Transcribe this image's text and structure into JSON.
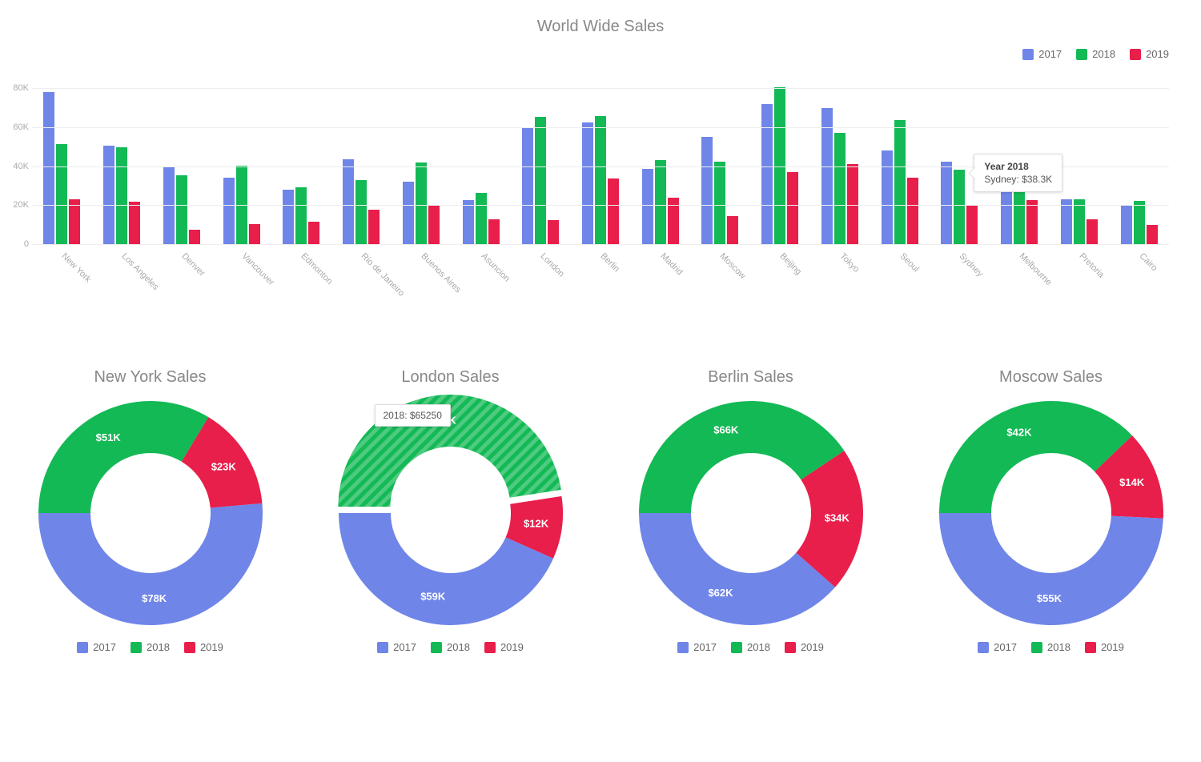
{
  "colors": {
    "2017": "#6f85e8",
    "2018": "#13b955",
    "2019": "#e81e4b"
  },
  "chart_data": [
    {
      "id": "bar",
      "type": "bar",
      "title": "World Wide Sales",
      "ylim": [
        0,
        80000
      ],
      "yticks": [
        0,
        20000,
        40000,
        60000,
        80000
      ],
      "ytick_labels": [
        "0",
        "20K",
        "40K",
        "60K",
        "80K"
      ],
      "categories": [
        "New York",
        "Los Angeles",
        "Denver",
        "Vancouver",
        "Edmonton",
        "Rio de Janeiro",
        "Buenos Aires",
        "Asuncion",
        "London",
        "Berlin",
        "Madrid",
        "Moscow",
        "Beijing",
        "Tokyo",
        "Seoul",
        "Sydney",
        "Melbourne",
        "Pretoria",
        "Cairo"
      ],
      "series": [
        {
          "name": "2017",
          "values": [
            78160,
            50540,
            39640,
            34230,
            27760,
            43400,
            32060,
            22480,
            59450,
            62320,
            38680,
            54900,
            71670,
            69780,
            48050,
            42070,
            45770,
            22940,
            20170
          ]
        },
        {
          "name": "2018",
          "values": [
            51180,
            49500,
            35200,
            40200,
            29100,
            32800,
            41900,
            26100,
            65250,
            65750,
            43000,
            42200,
            80400,
            57200,
            63500,
            38300,
            37800,
            23100,
            22200
          ]
        },
        {
          "name": "2019",
          "values": [
            22780,
            21700,
            7300,
            10400,
            11600,
            17800,
            20300,
            12600,
            12400,
            33800,
            24000,
            14400,
            36800,
            41100,
            34200,
            19800,
            22700,
            12600,
            9800
          ]
        }
      ],
      "legend": [
        "2017",
        "2018",
        "2019"
      ],
      "tooltip": {
        "title": "Year 2018",
        "body": "Sydney: $38.3K",
        "category_index": 15
      }
    },
    {
      "id": "donut-ny",
      "type": "donut",
      "title": "New York Sales",
      "series": [
        {
          "name": "2017",
          "value": 78160,
          "label": "$78K"
        },
        {
          "name": "2018",
          "value": 51180,
          "label": "$51K"
        },
        {
          "name": "2019",
          "value": 22780,
          "label": "$23K"
        }
      ],
      "legend": [
        "2017",
        "2018",
        "2019"
      ]
    },
    {
      "id": "donut-london",
      "type": "donut",
      "title": "London Sales",
      "series": [
        {
          "name": "2017",
          "value": 59450,
          "label": "$59K"
        },
        {
          "name": "2018",
          "value": 65250,
          "label": "$65K"
        },
        {
          "name": "2019",
          "value": 12400,
          "label": "$12K"
        }
      ],
      "legend": [
        "2017",
        "2018",
        "2019"
      ],
      "tooltip": {
        "text": "2018: $65250",
        "highlight_index": 1
      }
    },
    {
      "id": "donut-berlin",
      "type": "donut",
      "title": "Berlin Sales",
      "series": [
        {
          "name": "2017",
          "value": 62320,
          "label": "$62K"
        },
        {
          "name": "2018",
          "value": 65750,
          "label": "$66K"
        },
        {
          "name": "2019",
          "value": 33800,
          "label": "$34K"
        }
      ],
      "legend": [
        "2017",
        "2018",
        "2019"
      ]
    },
    {
      "id": "donut-moscow",
      "type": "donut",
      "title": "Moscow Sales",
      "series": [
        {
          "name": "2017",
          "value": 54900,
          "label": "$55K"
        },
        {
          "name": "2018",
          "value": 42200,
          "label": "$42K"
        },
        {
          "name": "2019",
          "value": 14400,
          "label": "$14K"
        }
      ],
      "legend": [
        "2017",
        "2018",
        "2019"
      ]
    }
  ]
}
